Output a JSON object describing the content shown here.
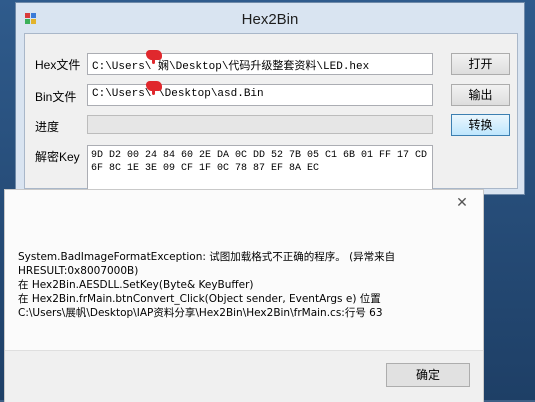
{
  "colors": {
    "desktop": "#2f5b8c",
    "window_frame": "#d9e4f1",
    "progress_fill": "#06b025",
    "redact": "#e0282d"
  },
  "window": {
    "title": "Hex2Bin",
    "icon": "app-grid-icon",
    "hex_label": "Hex文件",
    "hex_path": "C:\\Users\\ 娴\\Desktop\\代码升级整套资料\\LED.hex",
    "bin_label": "Bin文件",
    "bin_path": "C:\\Users\\  \\Desktop\\asd.Bin",
    "progress_label": "进度",
    "progress_value": 0,
    "key_label": "解密Key",
    "key_value": "9D D2 00 24 84 60 2E DA 0C DD 52 7B 05 C1 6B 01 FF 17 CD 6F 8C 1E 3E 09 CF 1F 0C 78 87 EF 8A EC",
    "open_button": "打开",
    "output_button": "输出",
    "convert_button": "转换"
  },
  "dialog": {
    "close_icon": "close-icon",
    "message_lines": [
      "System.BadImageFormatException: 试图加载格式不正确的程序。 (异常来自",
      "HRESULT:0x8007000B)",
      "   在 Hex2Bin.AESDLL.SetKey(Byte& KeyBuffer)",
      "   在 Hex2Bin.frMain.btnConvert_Click(Object sender, EventArgs e) 位置",
      "C:\\Users\\展帆\\Desktop\\IAP资料分享\\Hex2Bin\\Hex2Bin\\frMain.cs:行号 63"
    ],
    "ok_button": "确定"
  }
}
